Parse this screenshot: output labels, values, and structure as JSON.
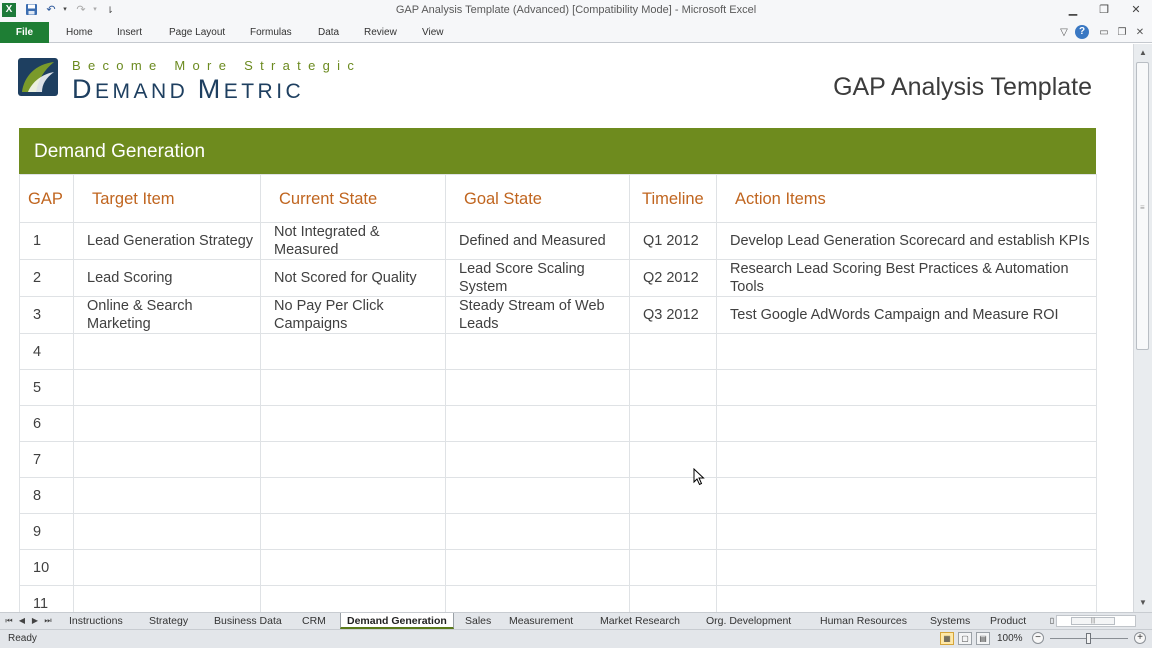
{
  "window": {
    "title": "GAP Analysis Template (Advanced)  [Compatibility Mode]  -  Microsoft Excel",
    "quick_access": {
      "excel_icon": "excel-icon",
      "save_icon": "save-icon",
      "undo_icon": "undo-icon",
      "redo_icon": "redo-icon",
      "customize_icon": "customize-icon"
    },
    "controls": {
      "minimize": "minimize-icon",
      "restore": "restore-icon",
      "close": "close-icon"
    }
  },
  "ribbon": {
    "file_label": "File",
    "tabs": [
      "Home",
      "Insert",
      "Page Layout",
      "Formulas",
      "Data",
      "Review",
      "View"
    ],
    "file_color": "#1e7e34"
  },
  "sheet": {
    "logo": {
      "tagline": "Become More Strategic",
      "name_big_1": "D",
      "name_small_1": "EMAND ",
      "name_big_2": "M",
      "name_small_2": "ETRIC",
      "tagline_color": "#6b8a1f",
      "name_color": "#1e3f60"
    },
    "doc_title": "GAP Analysis Template",
    "section_title": "Demand Generation",
    "section_color": "#6e8b1e",
    "header_color": "#c0651f",
    "columns": [
      "GAP",
      "Target Item",
      "Current State",
      "Goal State",
      "Timeline",
      "Action Items"
    ],
    "rows": [
      [
        "1",
        "Lead Generation Strategy",
        "Not Integrated & Measured",
        "Defined and Measured",
        "Q1 2012",
        "Develop Lead Generation Scorecard and establish KPIs"
      ],
      [
        "2",
        "Lead Scoring",
        "Not Scored for Quality",
        "Lead Score Scaling System",
        "Q2 2012",
        "Research Lead Scoring Best Practices & Automation Tools"
      ],
      [
        "3",
        "Online & Search Marketing",
        "No Pay Per Click Campaigns",
        "Steady Stream of Web Leads",
        "Q3 2012",
        "Test Google AdWords Campaign and Measure ROI"
      ],
      [
        "4",
        "",
        "",
        "",
        "",
        ""
      ],
      [
        "5",
        "",
        "",
        "",
        "",
        ""
      ],
      [
        "6",
        "",
        "",
        "",
        "",
        ""
      ],
      [
        "7",
        "",
        "",
        "",
        "",
        ""
      ],
      [
        "8",
        "",
        "",
        "",
        "",
        ""
      ],
      [
        "9",
        "",
        "",
        "",
        "",
        ""
      ],
      [
        "10",
        "",
        "",
        "",
        "",
        ""
      ],
      [
        "11",
        "",
        "",
        "",
        "",
        ""
      ]
    ]
  },
  "sheet_tabs": {
    "tabs": [
      "Instructions",
      "Strategy",
      "Business Data",
      "CRM",
      "Demand Generation",
      "Sales",
      "Measurement",
      "Market Research",
      "Org. Development",
      "Human Resources",
      "Systems",
      "Product"
    ],
    "active": "Demand Generation"
  },
  "status": {
    "text": "Ready",
    "zoom": "100%",
    "zoom_level": 100
  }
}
